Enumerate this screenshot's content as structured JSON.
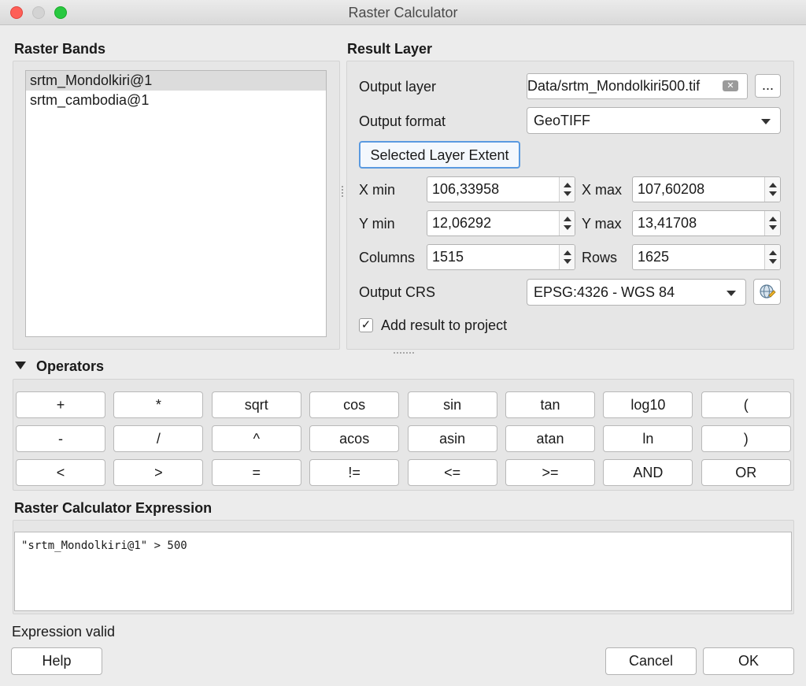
{
  "window": {
    "title": "Raster Calculator"
  },
  "raster_bands": {
    "title": "Raster Bands",
    "items": [
      "srtm_Mondolkiri@1",
      "srtm_cambodia@1"
    ],
    "selected_index": 0
  },
  "result_layer": {
    "title": "Result Layer",
    "output_layer_label": "Output layer",
    "output_layer_value": "Data/srtm_Mondolkiri500.tif",
    "browse_label": "...",
    "output_format_label": "Output format",
    "output_format_value": "GeoTIFF",
    "selected_extent_label": "Selected Layer Extent",
    "xmin_label": "X min",
    "xmin_value": "106,33958",
    "xmax_label": "X max",
    "xmax_value": "107,60208",
    "ymin_label": "Y min",
    "ymin_value": "12,06292",
    "ymax_label": "Y max",
    "ymax_value": "13,41708",
    "columns_label": "Columns",
    "columns_value": "1515",
    "rows_label": "Rows",
    "rows_value": "1625",
    "crs_label": "Output CRS",
    "crs_value": "EPSG:4326 - WGS 84",
    "add_result_label": "Add result to project",
    "add_result_checked": true
  },
  "operators": {
    "title": "Operators",
    "rows": [
      [
        "+",
        "*",
        "sqrt",
        "cos",
        "sin",
        "tan",
        "log10",
        "("
      ],
      [
        "-",
        "/",
        "^",
        "acos",
        "asin",
        "atan",
        "ln",
        ")"
      ],
      [
        "<",
        ">",
        "=",
        "!=",
        "<=",
        ">=",
        "AND",
        "OR"
      ]
    ]
  },
  "expression": {
    "title": "Raster Calculator Expression",
    "value": "\"srtm_Mondolkiri@1\" > 500",
    "status": "Expression valid"
  },
  "buttons": {
    "help": "Help",
    "cancel": "Cancel",
    "ok": "OK"
  },
  "colors": {
    "accent": "#4a90d9",
    "close": "#fe5f57",
    "maximize": "#28c840"
  }
}
